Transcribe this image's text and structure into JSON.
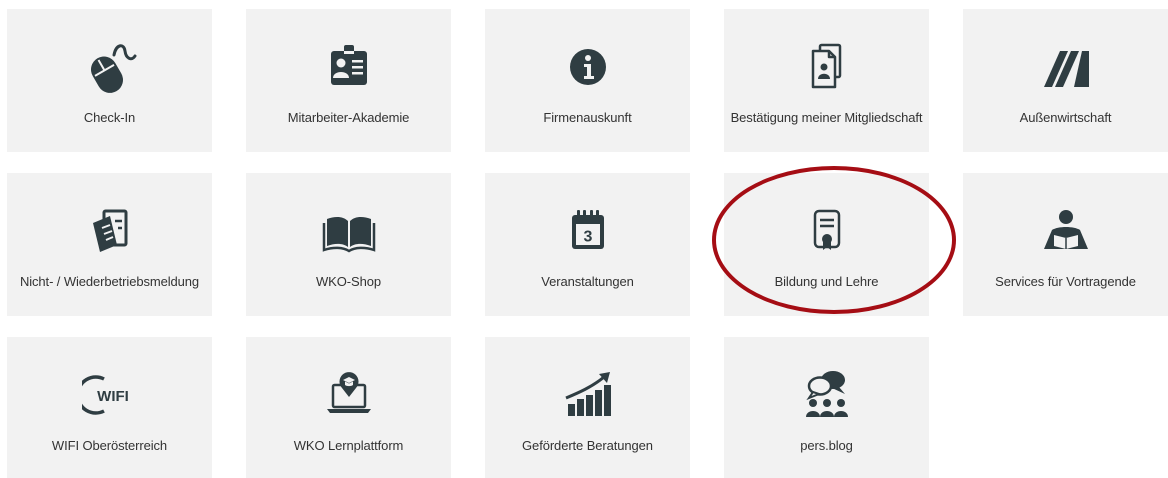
{
  "accent_color": "#2f3d42",
  "highlight_color": "#a50d14",
  "tiles": [
    {
      "label": "Check-In",
      "icon": "mouse-icon"
    },
    {
      "label": "Mitarbeiter-Akademie",
      "icon": "id-badge-icon"
    },
    {
      "label": "Firmenauskunft",
      "icon": "info-icon"
    },
    {
      "label": "Bestätigung meiner Mitgliedschaft",
      "icon": "documents-icon"
    },
    {
      "label": "Außenwirtschaft",
      "icon": "stripes-logo-icon"
    },
    {
      "label": "Nicht- / Wiederbetriebsmeldung",
      "icon": "form-documents-icon"
    },
    {
      "label": "WKO-Shop",
      "icon": "open-book-icon"
    },
    {
      "label": "Veranstaltungen",
      "icon": "calendar-icon"
    },
    {
      "label": "Bildung und Lehre",
      "icon": "certificate-icon"
    },
    {
      "label": "Services für Vortragende",
      "icon": "reader-icon"
    },
    {
      "label": "WIFI Oberösterreich",
      "icon": "wifi-logo-icon",
      "logo_text": "WIFI"
    },
    {
      "label": "WKO Lernplattform",
      "icon": "laptop-graduation-icon"
    },
    {
      "label": "Geförderte Beratungen",
      "icon": "growth-chart-icon"
    },
    {
      "label": "pers.blog",
      "icon": "chat-people-icon"
    }
  ]
}
